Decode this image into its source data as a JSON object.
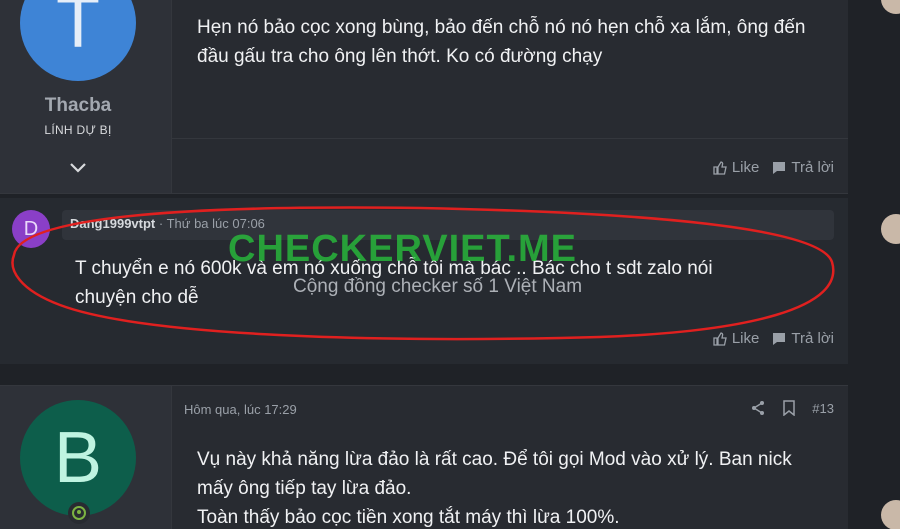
{
  "post1": {
    "avatar_letter": "T",
    "username": "Thacba",
    "user_title": "LÍNH DỰ BỊ",
    "message": "Hẹn nó bảo cọc xong bùng, bảo đến chỗ nó nó hẹn chỗ xa lắm, ông đến đầu gấu tra cho ông lên thớt. Ko có đường chạy",
    "like_label": "Like",
    "reply_label": "Trả lời"
  },
  "comment": {
    "avatar_letter": "D",
    "author": "Dang1999vtpt",
    "time": "· Thứ ba lúc 07:06",
    "message": "T chuyển e nó 600k và em nó xuống chỗ tôi mà bác .. Bác cho t sdt zalo nói chuyện cho dễ",
    "like_label": "Like",
    "reply_label": "Trả lời"
  },
  "watermark": {
    "title": "CHECKERVIET.ME",
    "subtitle": "Cộng đồng checker số 1 Việt Nam"
  },
  "post3": {
    "avatar_letter": "B",
    "time": "Hôm qua, lúc 17:29",
    "post_number": "#13",
    "message_lines": [
      "Vụ này khả năng lừa đảo là rất cao. Để tôi gọi Mod vào xử lý. Ban nick mấy ông tiếp tay lừa đảo.",
      "Toàn thấy bảo cọc tiền xong tắt máy thì lừa 100%."
    ]
  },
  "colors": {
    "annotation_circle": "#e0201f",
    "watermark_green": "#28c83c"
  }
}
